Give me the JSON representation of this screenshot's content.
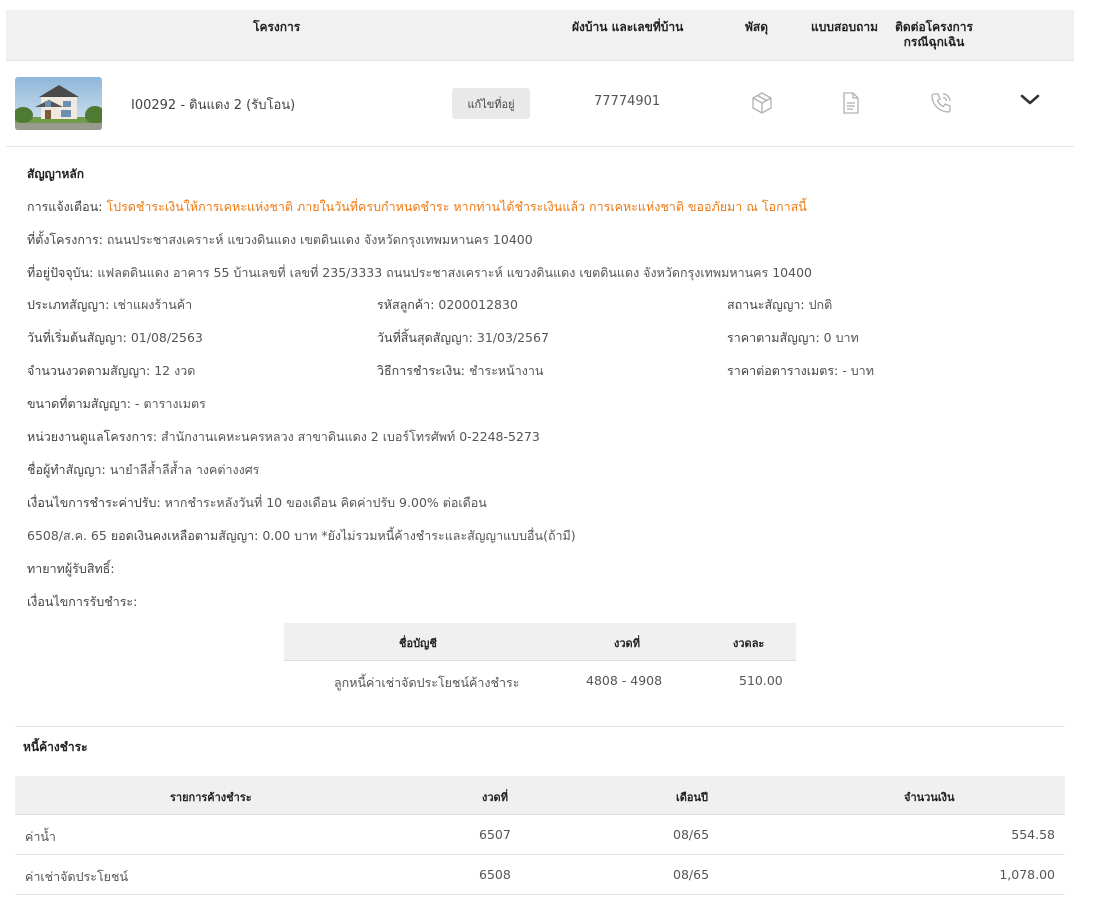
{
  "header": {
    "project": "โครงการ",
    "plan": "ผังบ้าน และเลขที่บ้าน",
    "parcel": "พัสดุ",
    "survey": "แบบสอบถาม",
    "contact_line1": "ติดต่อโครงการ",
    "contact_line2": "กรณีฉุกเฉิน"
  },
  "row": {
    "project_name": "I00292 - ดินแดง 2 (รับโอน)",
    "edit_label": "แก้ไขที่อยู่",
    "house_number": "77774901",
    "icons": [
      "package-icon",
      "document-icon",
      "phone-icon",
      "chevron-down-icon"
    ]
  },
  "contract": {
    "title": "สัญญาหลัก",
    "notice_label": "การแจ้งเตือน:",
    "notice_text": "โปรดชำระเงินให้การเคหะแห่งชาติ ภายในวันที่ครบกำหนดชำระ หากท่านได้ชำระเงินแล้ว การเคหะแห่งชาติ ขออภัยมา ณ โอกาสนี้",
    "location_label": "ที่ตั้งโครงการ:",
    "location": "ถนนประชาสงเคราะห์ แขวงดินแดง เขตดินแดง จังหวัดกรุงเทพมหานคร 10400",
    "address_label": "ที่อยู่ปัจจุบัน:",
    "address": "แฟลตดินแดง อาคาร 55 บ้านเลขที่ เลขที่ 235/3333 ถนนประชาสงเคราะห์ แขวงดินแดง เขตดินแดง จังหวัดกรุงเทพมหานคร 10400",
    "type_label": "ประเภทสัญญา:",
    "type": "เช่าแผงร้านค้า",
    "customer_label": "รหัสลูกค้า:",
    "customer": "0200012830",
    "status_label": "สถานะสัญญา:",
    "status": "ปกติ",
    "start_label": "วันที่เริ่มต้นสัญญา:",
    "start": "01/08/2563",
    "end_label": "วันที่สิ้นสุดสัญญา:",
    "end": "31/03/2567",
    "price_label": "ราคาตามสัญญา:",
    "price": "0 บาท",
    "installments_label": "จำนวนงวดตามสัญญา:",
    "installments": "12 งวด",
    "pay_method_label": "วิธีการชำระเงิน:",
    "pay_method": "ชำระหน้างาน",
    "sqm_price_label": "ราคาต่อตารางเมตร:",
    "sqm_price": "- บาท",
    "area_label": "ขนาดที่ตามสัญญา:",
    "area": "- ตารางเมตร",
    "unit_label": "หน่วยงานดูแลโครงการ:",
    "unit": "สำนักงานเคหะนครหลวง สาขาดินแดง 2 เบอร์โทรศัพท์ 0-2248-5273",
    "signer_label": "ชื่อผู้ทำสัญญา:",
    "signer": "นายําลีส้ำลีส้ำล างคต่างงศร",
    "penalty_label": "เงื่อนไขการชำระค่าปรับ:",
    "penalty": "หากชำระหลังวันที่ 10 ของเดือน คิดค่าปรับ 9.00% ต่อเดือน",
    "balance_prefix": "6508/ส.ค. 65",
    "balance_label": "ยอดเงินคงเหลือตามสัญญา:",
    "balance": "0.00 บาท *ยังไม่รวมหนี้ค้างชำระและสัญญาแบบอื่น(ถ้ามี)",
    "heir_label": "ทายาทผู้รับสิทธิ์:",
    "receive_label": "เงื่อนไขการรับชำระ:"
  },
  "payment_table": {
    "headers": [
      "ชื่อบัญชี",
      "งวดที่",
      "งวดละ"
    ],
    "rows": [
      [
        "ลูกหนี้ค่าเช่าจัดประโยชน์ค้างชำระ",
        "4808 - 4908",
        "510.00"
      ]
    ]
  },
  "debt": {
    "title": "หนี้ค้างชำระ",
    "headers": [
      "รายการค้างชำระ",
      "งวดที่",
      "เดือนปี",
      "จำนวนเงิน"
    ],
    "rows": [
      [
        "ค่าน้ำ",
        "6507",
        "08/65",
        "554.58"
      ],
      [
        "ค่าเช่าจัดประโยชน์",
        "6508",
        "08/65",
        "1,078.00"
      ]
    ]
  }
}
